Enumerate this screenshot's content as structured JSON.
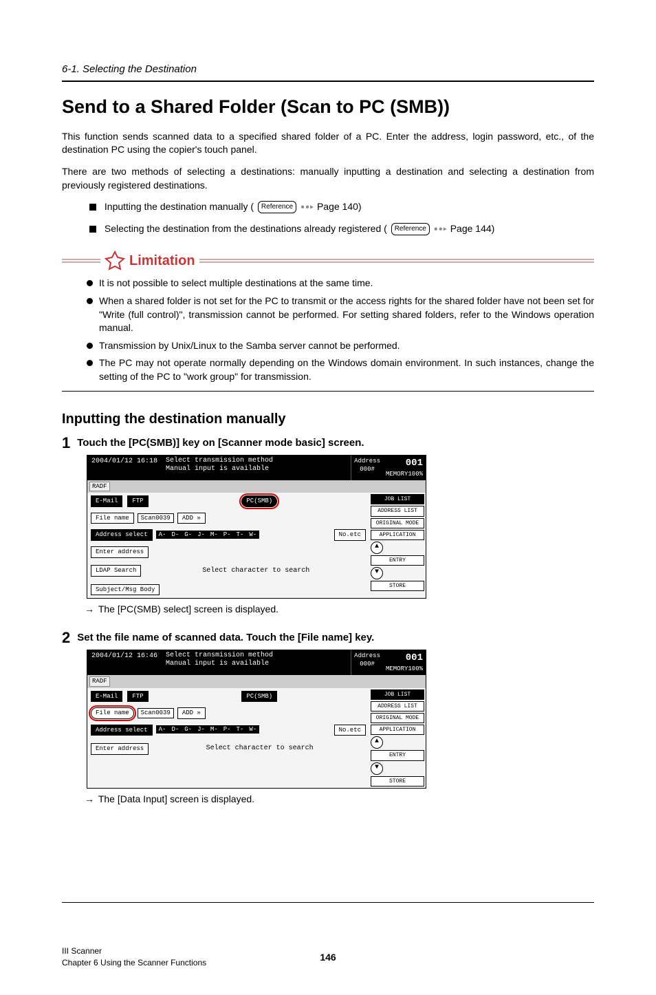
{
  "breadcrumb": "6-1. Selecting the Destination",
  "title": "Send to a Shared Folder (Scan to PC (SMB))",
  "intro1": "This function sends scanned data to a specified shared folder of a PC. Enter the address, login password, etc., of the destination PC using the copier's touch panel.",
  "intro2": "There are two methods of selecting a destinations: manually inputting a destination and selecting a destination from previously registered destinations.",
  "methods": {
    "m1_text": "Inputting the destination manually (",
    "m1_ref": "Reference",
    "m1_page": "Page 140)",
    "m2_text": "Selecting the destination from the destinations already registered (",
    "m2_ref": "Reference",
    "m2_page": "Page 144)"
  },
  "limitation": {
    "label": "Limitation",
    "items": [
      "It is not possible to select multiple destinations at the same time.",
      "When a shared folder is not set for the PC to transmit or the access rights for the shared folder have not been set for \"Write (full control)\", transmission cannot be performed. For setting shared folders, refer to the Windows operation manual.",
      "Transmission by Unix/Linux to the Samba server cannot be performed.",
      "The PC may not operate normally depending on the Windows domain environment. In such instances, change the setting of the PC to \"work group\" for transmission."
    ]
  },
  "subheading": "Inputting the destination manually",
  "steps": [
    {
      "num": "1",
      "title": "Touch the [PC(SMB)] key on [Scanner mode basic] screen.",
      "result": "The [PC(SMB) select] screen is displayed.",
      "screen": {
        "datetime": "2004/01/12 16:18",
        "msg1": "Select transmission method",
        "msg2": "Manual input is available",
        "radf": "RADF",
        "addr_lbl": "Address",
        "addr_val": "000#",
        "big": "001",
        "memory": "MEMORY100%",
        "tabs": {
          "email": "E-Mail",
          "ftp": "FTP",
          "pcsmb": "PC(SMB)",
          "joblist": "JOB LIST"
        },
        "filename_lbl": "File name",
        "filename_val": "Scan0039",
        "add": "ADD »",
        "addrlist": "ADDRESS LIST",
        "addr_select": "Address select",
        "alpha_groups": [
          "A-",
          "D-",
          "G-",
          "J-",
          "M-",
          "P-",
          "T-",
          "W-"
        ],
        "noetc": "No.etc",
        "orig": "ORIGINAL MODE",
        "enter_addr": "Enter address",
        "ldap": "LDAP Search",
        "subj": "Subject/Msg Body",
        "center": "Select character to search",
        "app": "APPLICATION",
        "entry": "ENTRY",
        "store": "STORE",
        "highlight": "pcsmb"
      }
    },
    {
      "num": "2",
      "title": "Set the file name of scanned data. Touch the [File name] key.",
      "result": "The [Data Input] screen is displayed.",
      "screen": {
        "datetime": "2004/01/12 16:46",
        "msg1": "Select transmission method",
        "msg2": "Manual input is available",
        "radf": "RADF",
        "addr_lbl": "Address",
        "addr_val": "000#",
        "big": "001",
        "memory": "MEMORY100%",
        "tabs": {
          "email": "E-Mail",
          "ftp": "FTP",
          "pcsmb": "PC(SMB)",
          "joblist": "JOB LIST"
        },
        "filename_lbl": "File name",
        "filename_val": "Scan0039",
        "add": "ADD »",
        "addrlist": "ADDRESS LIST",
        "addr_select": "Address select",
        "alpha_groups": [
          "A-",
          "D-",
          "G-",
          "J-",
          "M-",
          "P-",
          "T-",
          "W-"
        ],
        "noetc": "No.etc",
        "orig": "ORIGINAL MODE",
        "enter_addr": "Enter address",
        "center": "Select character to search",
        "app": "APPLICATION",
        "entry": "ENTRY",
        "store": "STORE",
        "highlight": "filename"
      }
    }
  ],
  "footer": {
    "section": "III Scanner",
    "chapter": "Chapter 6 Using the Scanner Functions",
    "page": "146"
  }
}
